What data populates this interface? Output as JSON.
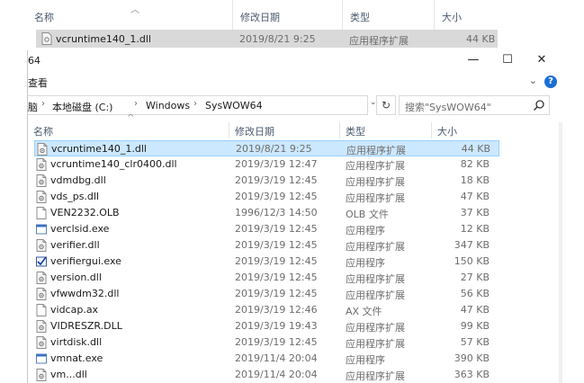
{
  "background_window": {
    "columns": {
      "name": "名称",
      "date": "修改日期",
      "type": "类型",
      "size": "大小"
    },
    "row": {
      "name": "vcruntime140_1.dll",
      "date": "2019/8/21 9:25",
      "type": "应用程序扩展",
      "size": "44 KB"
    }
  },
  "window": {
    "title_fragment": "64",
    "caption": {
      "minimize": "—",
      "maximize": "☐",
      "close": "✕"
    },
    "ribbon": {
      "view_tab": "查看",
      "expand_chevron": "⌄",
      "help": "?"
    },
    "address": {
      "crumbs": [
        "脑",
        "本地磁盘 (C:)",
        "Windows",
        "SysWOW64"
      ],
      "separator": "›",
      "dropdown": "⌄",
      "refresh": "↻"
    },
    "search": {
      "placeholder": "搜索\"SysWOW64\""
    },
    "columns": {
      "name": "名称",
      "date": "修改日期",
      "type": "类型",
      "size": "大小",
      "sort_arrow": "^"
    },
    "files": [
      {
        "name": "vcruntime140_1.dll",
        "date": "2019/8/21 9:25",
        "type": "应用程序扩展",
        "size": "44 KB",
        "icon": "dll-file-icon",
        "selected": true
      },
      {
        "name": "vcruntime140_clr0400.dll",
        "date": "2019/3/19 12:47",
        "type": "应用程序扩展",
        "size": "82 KB",
        "icon": "dll-file-icon"
      },
      {
        "name": "vdmdbg.dll",
        "date": "2019/3/19 12:45",
        "type": "应用程序扩展",
        "size": "18 KB",
        "icon": "dll-file-icon"
      },
      {
        "name": "vds_ps.dll",
        "date": "2019/3/19 12:45",
        "type": "应用程序扩展",
        "size": "47 KB",
        "icon": "dll-file-icon"
      },
      {
        "name": "VEN2232.OLB",
        "date": "1996/12/3 14:50",
        "type": "OLB 文件",
        "size": "37 KB",
        "icon": "blank-file-icon"
      },
      {
        "name": "verclsid.exe",
        "date": "2019/3/19 12:45",
        "type": "应用程序",
        "size": "12 KB",
        "icon": "exe-window-icon"
      },
      {
        "name": "verifier.dll",
        "date": "2019/3/19 12:45",
        "type": "应用程序扩展",
        "size": "347 KB",
        "icon": "dll-file-icon"
      },
      {
        "name": "verifiergui.exe",
        "date": "2019/3/19 12:45",
        "type": "应用程序",
        "size": "150 KB",
        "icon": "checkmark-app-icon"
      },
      {
        "name": "version.dll",
        "date": "2019/3/19 12:45",
        "type": "应用程序扩展",
        "size": "27 KB",
        "icon": "dll-file-icon"
      },
      {
        "name": "vfwwdm32.dll",
        "date": "2019/3/19 12:45",
        "type": "应用程序扩展",
        "size": "56 KB",
        "icon": "dll-file-icon"
      },
      {
        "name": "vidcap.ax",
        "date": "2019/3/19 12:46",
        "type": "AX 文件",
        "size": "47 KB",
        "icon": "blank-file-icon"
      },
      {
        "name": "VIDRESZR.DLL",
        "date": "2019/3/19 19:43",
        "type": "应用程序扩展",
        "size": "99 KB",
        "icon": "dll-file-icon"
      },
      {
        "name": "virtdisk.dll",
        "date": "2019/3/19 12:45",
        "type": "应用程序扩展",
        "size": "57 KB",
        "icon": "dll-file-icon"
      },
      {
        "name": "vmnat.exe",
        "date": "2019/11/4 20:04",
        "type": "应用程序",
        "size": "390 KB",
        "icon": "exe-window-icon"
      },
      {
        "name": "vm...dll",
        "date": "2019/11/4 20:04",
        "type": "应用程序扩展",
        "size": "363 KB",
        "icon": "dll-file-icon"
      }
    ]
  }
}
